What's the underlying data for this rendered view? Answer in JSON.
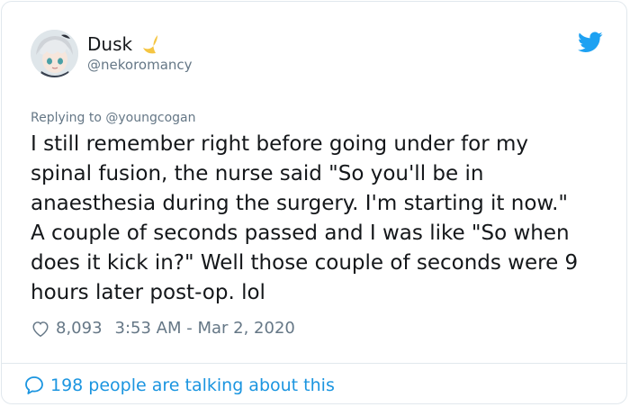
{
  "user": {
    "display_name": "Dusk",
    "handle": "@nekoromancy"
  },
  "tweet": {
    "replying_to_prefix": "Replying to ",
    "replying_to_handle": "@youngcogan",
    "text": "I still remember right before going under for my\nspinal fusion, the nurse said \"So you'll be in\nanaesthesia during the surgery. I'm starting it now.\"\nA couple of seconds passed and I was like \"So when\ndoes it kick in?\" Well those couple of seconds were 9\nhours later post-op. lol",
    "likes": "8,093",
    "timestamp": "3:53 AM - Mar 2, 2020"
  },
  "footer": {
    "talking": "198 people are talking about this"
  },
  "colors": {
    "twitter_blue": "#1da1f2",
    "link_blue": "#1b95e0",
    "secondary_text": "#657786",
    "moon_yellow": "#f5c542"
  },
  "icons": [
    "avatar",
    "crescent-moon-icon",
    "twitter-bird-icon",
    "heart-icon",
    "speech-bubble-icon"
  ]
}
